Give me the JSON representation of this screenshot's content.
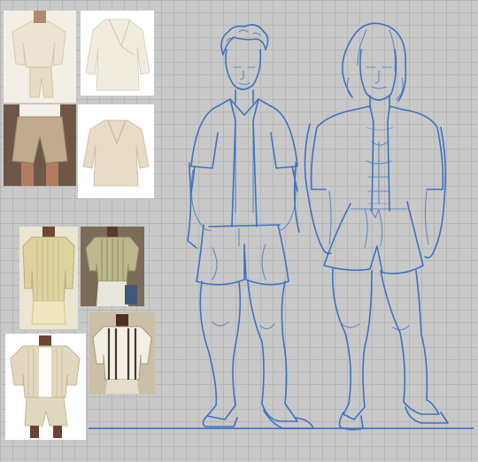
{
  "canvas": {
    "background_color": "#c9c9c9",
    "grid_color": "#b6b6b6",
    "sketch_color": "#3f72bf"
  },
  "references": [
    {
      "id": "ref-cream-shirt-shorts-outfit",
      "palette": [
        "#f3efe6",
        "#ebe3cf",
        "#cdb99a"
      ]
    },
    {
      "id": "ref-wrap-shirt-cream",
      "palette": [
        "#ffffff",
        "#efe9dc"
      ]
    },
    {
      "id": "ref-khaki-pleated-shorts",
      "palette": [
        "#6e5545",
        "#bca88e"
      ]
    },
    {
      "id": "ref-wrap-shirt-beige",
      "palette": [
        "#ffffff",
        "#e7dcc9"
      ]
    },
    {
      "id": "ref-striped-shirt-yellow",
      "palette": [
        "#e9e2cc",
        "#d9cf9c"
      ]
    },
    {
      "id": "ref-striped-shirt-olive",
      "palette": [
        "#7a6b58",
        "#b8b58a"
      ]
    },
    {
      "id": "ref-striped-set-white-tee",
      "palette": [
        "#ffffff",
        "#ddd3b7"
      ]
    },
    {
      "id": "ref-bold-stripe-shirt",
      "palette": [
        "#c9bca4",
        "#f2eee4",
        "#3f3a2e"
      ]
    }
  ],
  "sketch": {
    "figures": [
      "figure-left",
      "figure-right"
    ]
  }
}
